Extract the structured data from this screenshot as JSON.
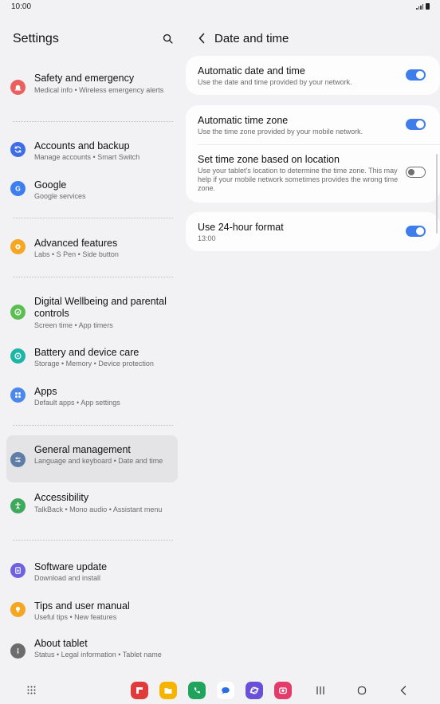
{
  "status": {
    "time": "10:00"
  },
  "left": {
    "title": "Settings",
    "items": [
      {
        "id": "safety",
        "title": "Safety and emergency",
        "subtitle": "Medical info • Wireless emergency alerts",
        "color": "#e9605f"
      },
      {
        "id": "accounts",
        "title": "Accounts and backup",
        "subtitle": "Manage accounts • Smart Switch",
        "color": "#3d6ee6"
      },
      {
        "id": "google",
        "title": "Google",
        "subtitle": "Google services",
        "color": "#3d7ef0"
      },
      {
        "id": "advanced",
        "title": "Advanced features",
        "subtitle": "Labs • S Pen • Side button",
        "color": "#f5a623"
      },
      {
        "id": "wellbeing",
        "title": "Digital Wellbeing and parental controls",
        "subtitle": "Screen time • App timers",
        "color": "#5cbe52"
      },
      {
        "id": "battery",
        "title": "Battery and device care",
        "subtitle": "Storage • Memory • Device protection",
        "color": "#1fb5a6"
      },
      {
        "id": "apps",
        "title": "Apps",
        "subtitle": "Default apps • App settings",
        "color": "#4c88ec"
      },
      {
        "id": "general",
        "title": "General management",
        "subtitle": "Language and keyboard • Date and time",
        "color": "#5f7da6"
      },
      {
        "id": "accessibility",
        "title": "Accessibility",
        "subtitle": "TalkBack • Mono audio • Assistant menu",
        "color": "#3fa95b"
      },
      {
        "id": "software",
        "title": "Software update",
        "subtitle": "Download and install",
        "color": "#6f62e0"
      },
      {
        "id": "tips",
        "title": "Tips and user manual",
        "subtitle": "Useful tips • New features",
        "color": "#f5a623"
      },
      {
        "id": "about",
        "title": "About tablet",
        "subtitle": "Status • Legal information • Tablet name",
        "color": "#6c6c6c"
      }
    ]
  },
  "right": {
    "title": "Date and time",
    "settings": [
      {
        "id": "auto-date",
        "title": "Automatic date and time",
        "subtitle": "Use the date and time provided by your network.",
        "enabled": true
      },
      {
        "id": "auto-zone",
        "title": "Automatic time zone",
        "subtitle": "Use the time zone provided by your mobile network.",
        "enabled": true
      },
      {
        "id": "location-zone",
        "title": "Set time zone based on location",
        "subtitle": "Use your tablet's location to determine the time zone. This may help if your mobile network sometimes provides the wrong time zone.",
        "enabled": false
      },
      {
        "id": "format-24",
        "title": "Use 24-hour format",
        "subtitle": "13:00",
        "enabled": true
      }
    ]
  },
  "dock": {
    "apps": [
      {
        "name": "flipboard-app",
        "color": "#e03a3a"
      },
      {
        "name": "my-files-app",
        "color": "#f5b400"
      },
      {
        "name": "phone-app",
        "color": "#20a45d"
      },
      {
        "name": "messages-app",
        "color": "#ffffff"
      },
      {
        "name": "internet-app",
        "color": "#6a4fd8"
      },
      {
        "name": "camera-app",
        "color": "#e43c6a"
      }
    ]
  }
}
